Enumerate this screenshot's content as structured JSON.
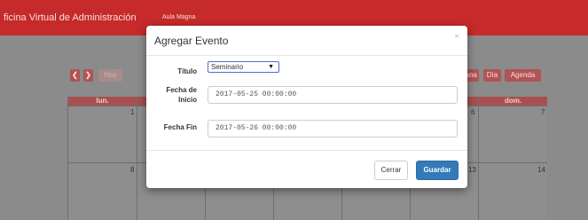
{
  "navbar": {
    "brand": "ficina Virtual de Administración",
    "link": "Aula Magna"
  },
  "calendar": {
    "prev_icon": "chevron-left-icon",
    "next_icon": "chevron-right-icon",
    "today_label": "Hoy",
    "view_buttons": {
      "week": "ana",
      "day": "Día",
      "agenda": "Agenda"
    },
    "headers": {
      "mon": "lun.",
      "sun": "dom."
    },
    "days": {
      "row1_mon": "1",
      "row1_sat": "6",
      "row1_sun": "7",
      "row2_mon": "8",
      "row2_sat": "13",
      "row2_sun": "14"
    }
  },
  "modal": {
    "title": "Agregar Evento",
    "close_glyph": "×",
    "fields": {
      "title_label": "Título",
      "title_value": "Seminario",
      "start_label_line1": "Fecha de",
      "start_label_line2": "Inicio",
      "start_value": "2017-05-25 00:00:00",
      "end_label": "Fecha Fin",
      "end_value": "2017-05-26 00:00:00"
    },
    "buttons": {
      "close": "Cerrar",
      "save": "Guardar"
    }
  },
  "colors": {
    "navbar": "#c62a2a",
    "primary_button": "#337ab7",
    "calendar_header": "#a85050"
  }
}
